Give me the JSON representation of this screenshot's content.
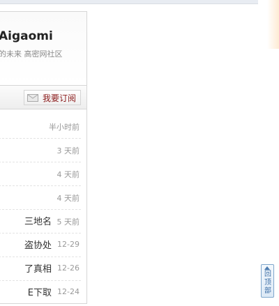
{
  "header": {
    "brand": "Aigaomi",
    "slogan": "的未来 高密网社区"
  },
  "toolbar": {
    "subscribe_label": "我要订阅",
    "subscribe_icon": "mail-icon"
  },
  "list": [
    {
      "title": "",
      "time": "半小时前"
    },
    {
      "title": "",
      "time": "3 天前"
    },
    {
      "title": "",
      "time": "4 天前"
    },
    {
      "title": "",
      "time": "4 天前"
    },
    {
      "title": "三地名",
      "time": "5 天前"
    },
    {
      "title": "盗协处",
      "time": "12-29"
    },
    {
      "title": "了真相",
      "time": "12-26"
    },
    {
      "title": "E下取",
      "time": "12-24"
    }
  ],
  "back_to_top": {
    "label": "回顶部",
    "icon": "arrow-up-icon"
  }
}
